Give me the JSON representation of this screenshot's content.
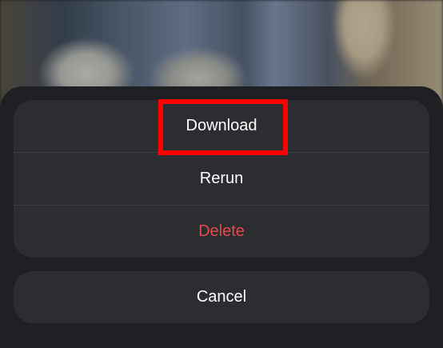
{
  "action_sheet": {
    "items": [
      {
        "label": "Download",
        "style": "default"
      },
      {
        "label": "Rerun",
        "style": "default"
      },
      {
        "label": "Delete",
        "style": "destructive"
      }
    ],
    "cancel_label": "Cancel"
  },
  "colors": {
    "sheet_background": "#1f2023",
    "group_background": "#2c2d31",
    "text": "#ffffff",
    "destructive": "#e5484d",
    "highlight_box": "#ff0000"
  }
}
